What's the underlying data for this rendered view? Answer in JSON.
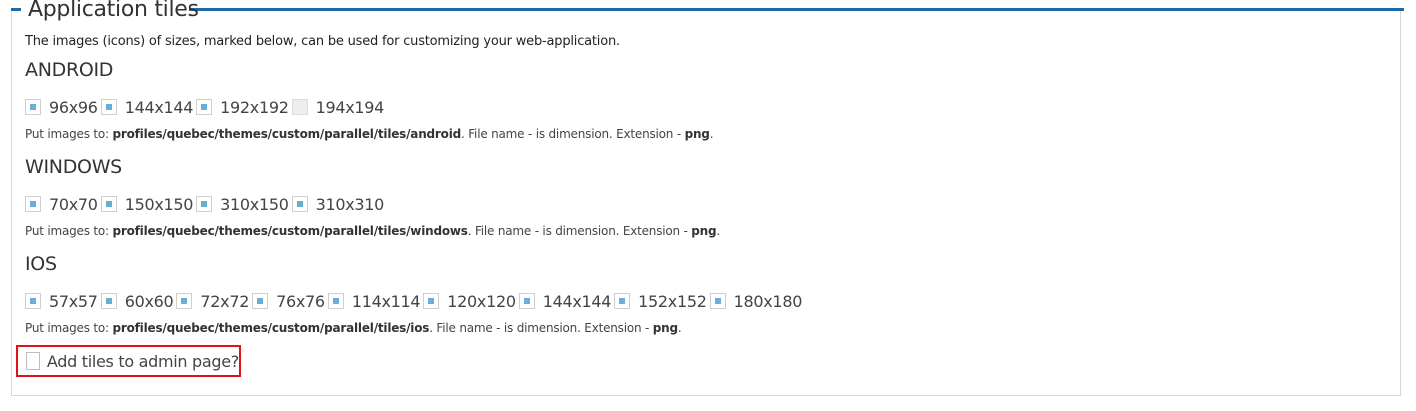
{
  "legend": "Application tiles",
  "description": "The images (icons) of sizes, marked below, can be used for customizing your web-application.",
  "sections": [
    {
      "title": "ANDROID",
      "sizes": [
        {
          "label": "96x96",
          "checked": true
        },
        {
          "label": "144x144",
          "checked": true
        },
        {
          "label": "192x192",
          "checked": true
        },
        {
          "label": "194x194",
          "checked": false
        }
      ],
      "note_prefix": "Put images to: ",
      "note_path": "profiles/quebec/themes/custom/parallel/tiles/android",
      "note_mid": ". File name - is dimension. Extension - ",
      "note_ext": "png",
      "note_end": "."
    },
    {
      "title": "WINDOWS",
      "sizes": [
        {
          "label": "70x70",
          "checked": true
        },
        {
          "label": "150x150",
          "checked": true
        },
        {
          "label": "310x150",
          "checked": true
        },
        {
          "label": "310x310",
          "checked": true
        }
      ],
      "note_prefix": "Put images to: ",
      "note_path": "profiles/quebec/themes/custom/parallel/tiles/windows",
      "note_mid": ". File name - is dimension. Extension - ",
      "note_ext": "png",
      "note_end": "."
    },
    {
      "title": "IOS",
      "sizes": [
        {
          "label": "57x57",
          "checked": true
        },
        {
          "label": "60x60",
          "checked": true
        },
        {
          "label": "72x72",
          "checked": true
        },
        {
          "label": "76x76",
          "checked": true
        },
        {
          "label": "114x114",
          "checked": true
        },
        {
          "label": "120x120",
          "checked": true
        },
        {
          "label": "144x144",
          "checked": true
        },
        {
          "label": "152x152",
          "checked": true
        },
        {
          "label": "180x180",
          "checked": true
        }
      ],
      "note_prefix": "Put images to: ",
      "note_path": "profiles/quebec/themes/custom/parallel/tiles/ios",
      "note_mid": ". File name - is dimension. Extension - ",
      "note_ext": "png",
      "note_end": "."
    }
  ],
  "admin_option": {
    "label": "Add tiles to admin page?",
    "checked": false
  },
  "colors": {
    "accent": "#1c6aa6",
    "checkbox_mark": "#6aaed6",
    "highlight": "#e0131b"
  }
}
